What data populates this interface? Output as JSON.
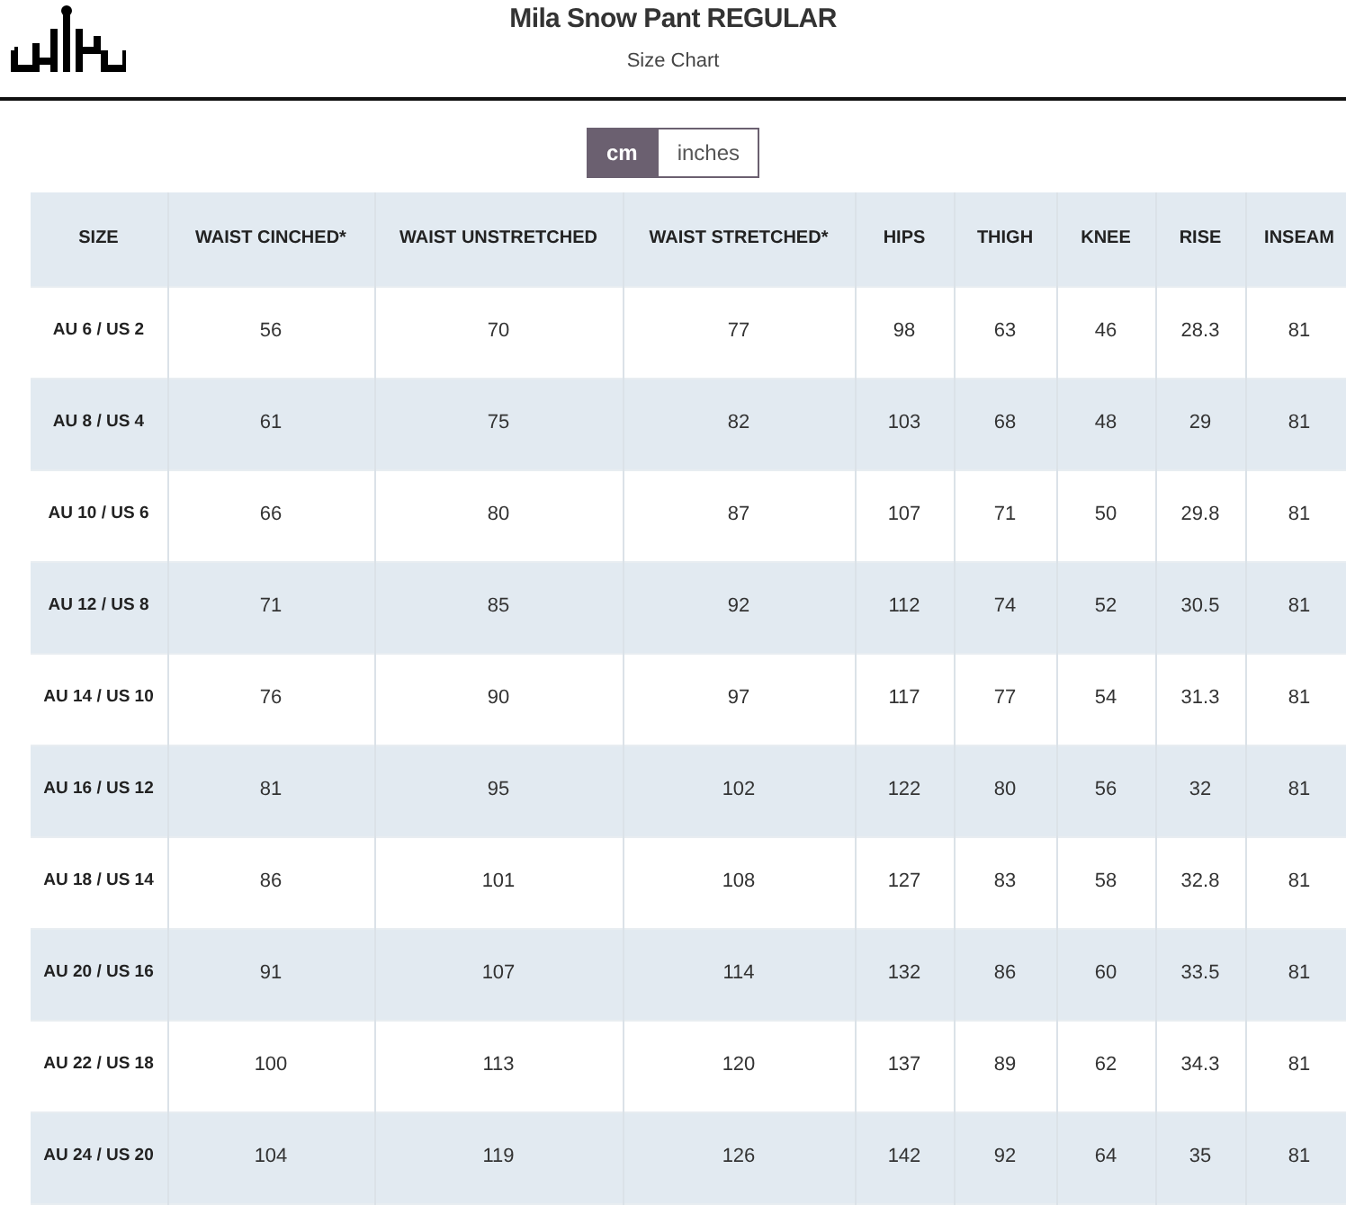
{
  "header": {
    "title": "Mila Snow Pant REGULAR",
    "subtitle": "Size Chart"
  },
  "unit_toggle": [
    {
      "label": "cm",
      "selected": true
    },
    {
      "label": "inches",
      "selected": false
    }
  ],
  "table": {
    "columns": [
      "SIZE",
      "WAIST CINCHED*",
      "WAIST UNSTRETCHED",
      "WAIST STRETCHED*",
      "HIPS",
      "THIGH",
      "KNEE",
      "RISE",
      "INSEAM"
    ],
    "rows": [
      [
        "AU 6 / US 2",
        "56",
        "70",
        "77",
        "98",
        "63",
        "46",
        "28.3",
        "81"
      ],
      [
        "AU 8 / US 4",
        "61",
        "75",
        "82",
        "103",
        "68",
        "48",
        "29",
        "81"
      ],
      [
        "AU 10 / US 6",
        "66",
        "80",
        "87",
        "107",
        "71",
        "50",
        "29.8",
        "81"
      ],
      [
        "AU 12 / US 8",
        "71",
        "85",
        "92",
        "112",
        "74",
        "52",
        "30.5",
        "81"
      ],
      [
        "AU 14 / US 10",
        "76",
        "90",
        "97",
        "117",
        "77",
        "54",
        "31.3",
        "81"
      ],
      [
        "AU 16 / US 12",
        "81",
        "95",
        "102",
        "122",
        "80",
        "56",
        "32",
        "81"
      ],
      [
        "AU 18 / US 14",
        "86",
        "101",
        "108",
        "127",
        "83",
        "58",
        "32.8",
        "81"
      ],
      [
        "AU 20 / US 16",
        "91",
        "107",
        "114",
        "132",
        "86",
        "60",
        "33.5",
        "81"
      ],
      [
        "AU 22 / US 18",
        "100",
        "113",
        "120",
        "137",
        "89",
        "62",
        "34.3",
        "81"
      ],
      [
        "AU 24 / US 20",
        "104",
        "119",
        "126",
        "142",
        "92",
        "64",
        "35",
        "81"
      ]
    ]
  }
}
